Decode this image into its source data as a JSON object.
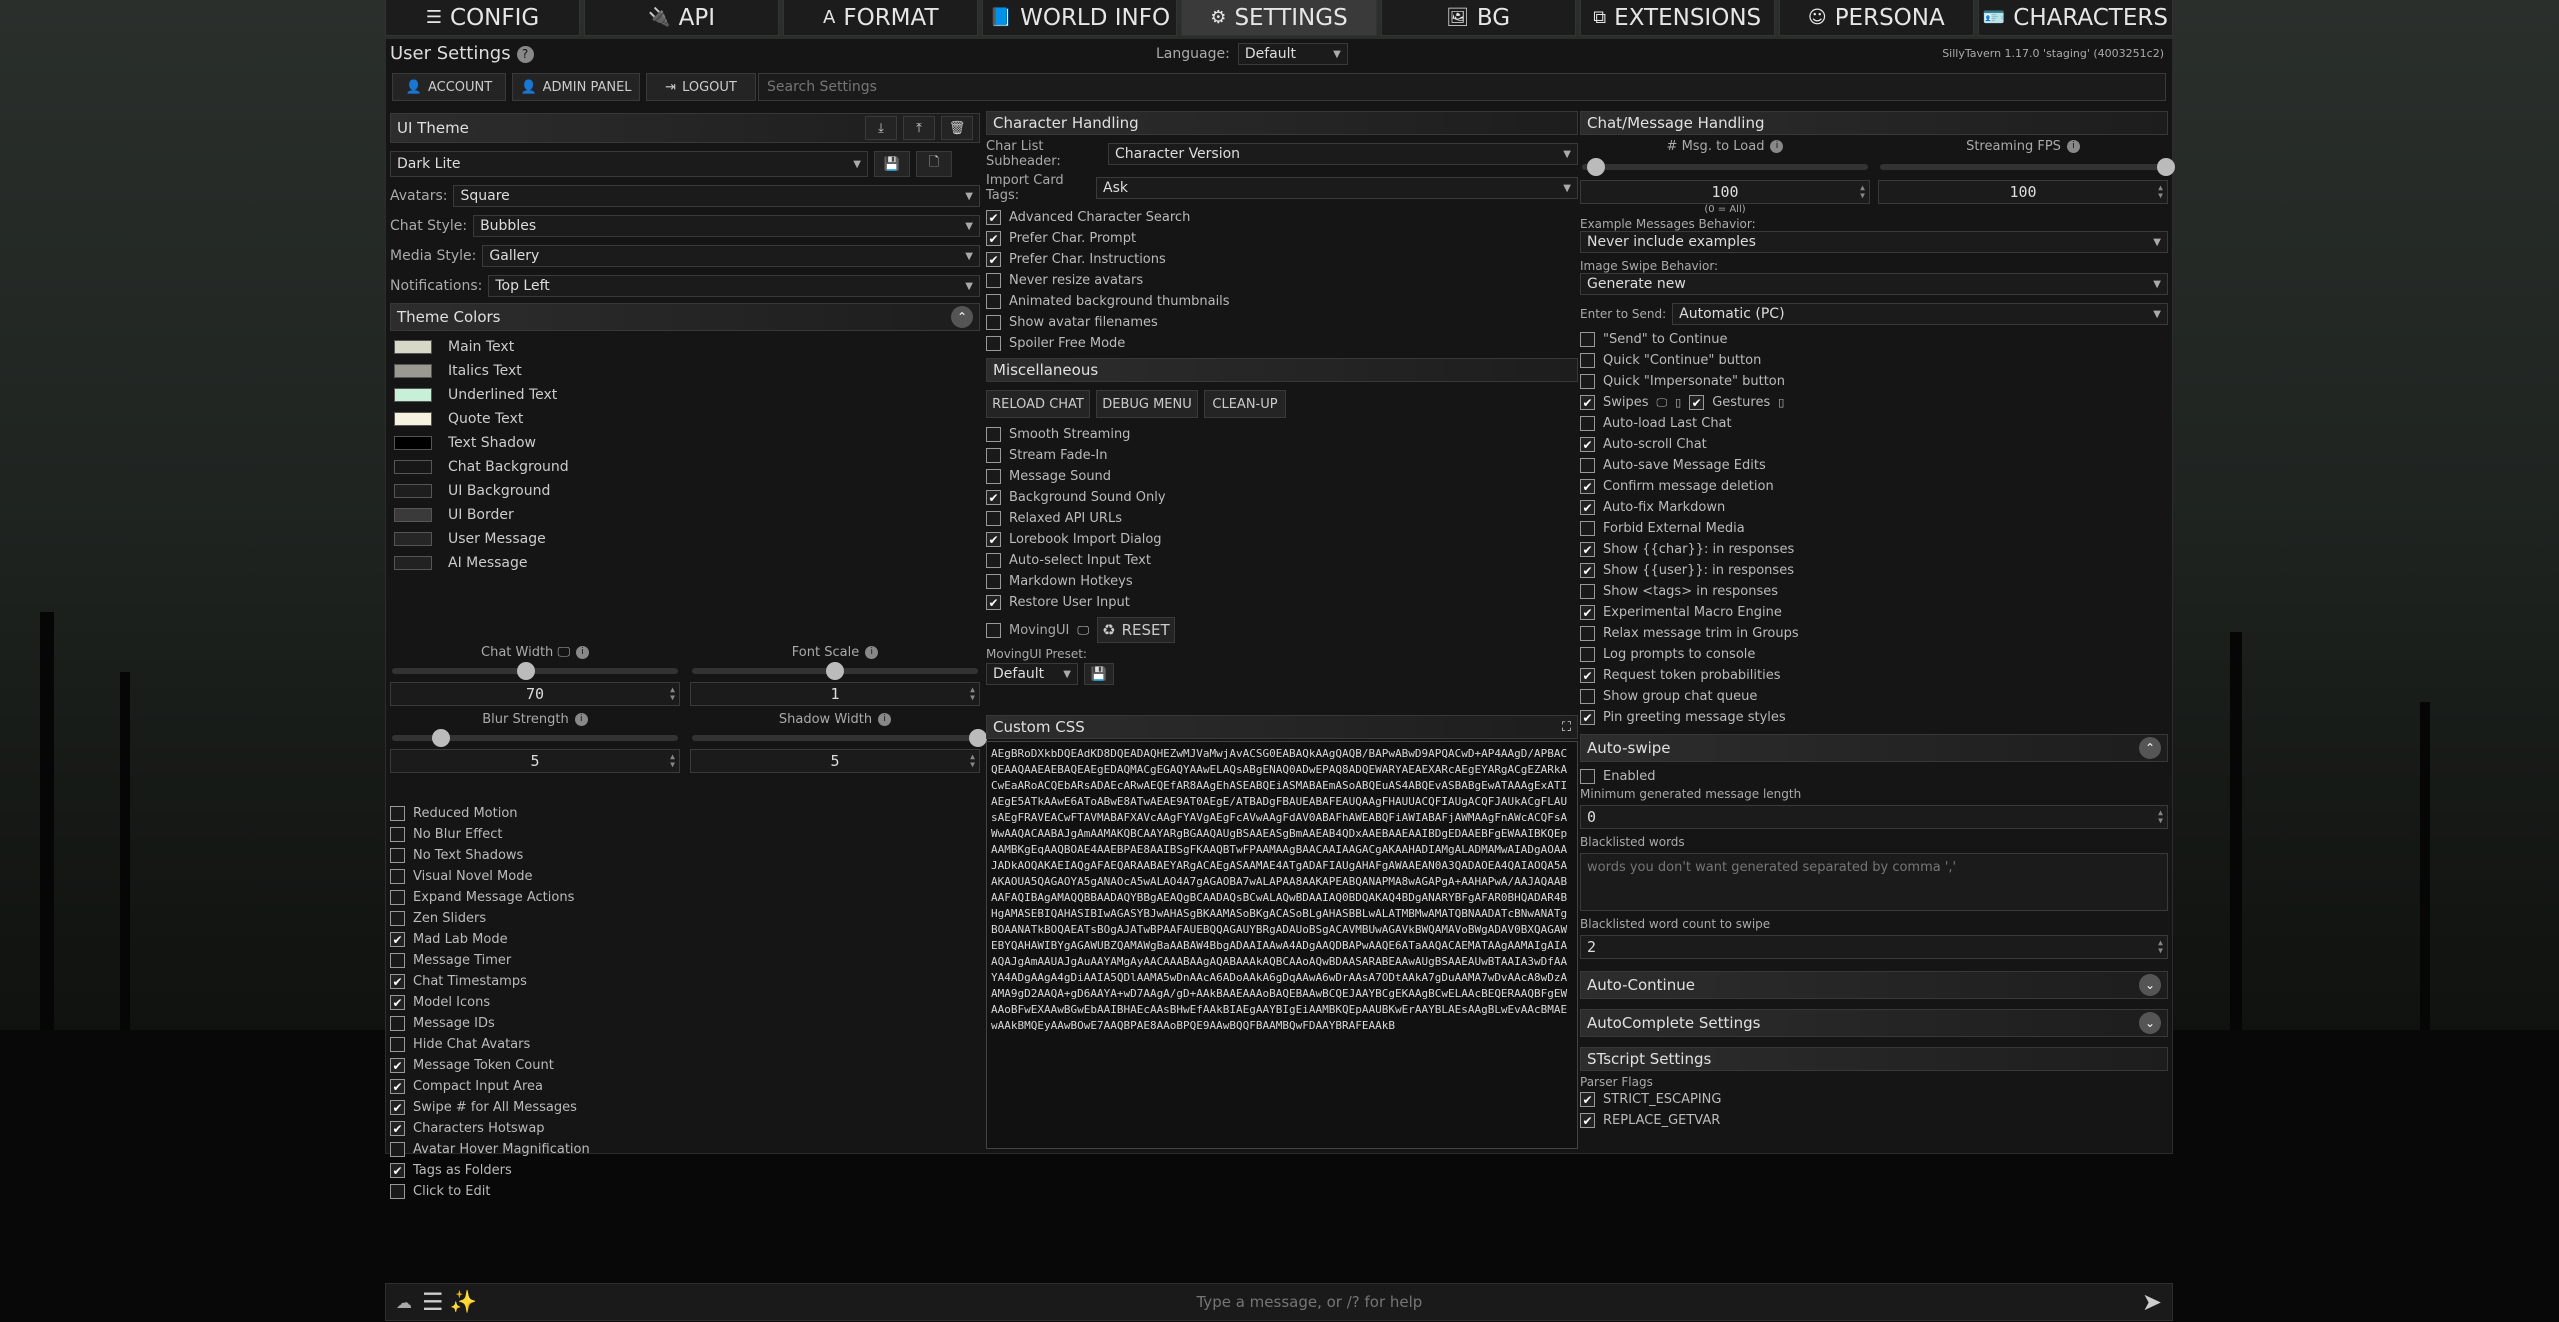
{
  "nav": {
    "tabs": [
      {
        "label": "CONFIG",
        "icon": "sliders-icon"
      },
      {
        "label": "API",
        "icon": "plug-icon"
      },
      {
        "label": "FORMAT",
        "icon": "font-icon"
      },
      {
        "label": "WORLD INFO",
        "icon": "book-icon"
      },
      {
        "label": "SETTINGS",
        "icon": "user-gear-icon"
      },
      {
        "label": "BG",
        "icon": "image-icon"
      },
      {
        "label": "EXTENSIONS",
        "icon": "cubes-icon"
      },
      {
        "label": "PERSONA",
        "icon": "face-icon"
      },
      {
        "label": "CHARACTERS",
        "icon": "id-card-icon"
      }
    ],
    "active": "SETTINGS"
  },
  "header": {
    "title": "User Settings",
    "language_label": "Language:",
    "language_value": "Default",
    "version": "SillyTavern 1.17.0 'staging' (4003251c2)",
    "buttons": {
      "account": "ACCOUNT",
      "admin": "ADMIN PANEL",
      "logout": "LOGOUT"
    },
    "search_placeholder": "Search Settings"
  },
  "ui_theme": {
    "title": "UI Theme",
    "preset": "Dark Lite",
    "avatars_label": "Avatars:",
    "avatars_value": "Square",
    "chat_style_label": "Chat Style:",
    "chat_style_value": "Bubbles",
    "media_style_label": "Media Style:",
    "media_style_value": "Gallery",
    "notifications_label": "Notifications:",
    "notifications_value": "Top Left",
    "theme_colors_title": "Theme Colors",
    "colors": [
      {
        "label": "Main Text",
        "color": "#d8d8c8"
      },
      {
        "label": "Italics Text",
        "color": "#9a9a90"
      },
      {
        "label": "Underlined Text",
        "color": "#c8f0d8"
      },
      {
        "label": "Quote Text",
        "color": "#f6f2e0"
      },
      {
        "label": "Text Shadow",
        "color": "#000000"
      },
      {
        "label": "Chat Background",
        "color": "#171717"
      },
      {
        "label": "UI Background",
        "color": "#1e1e1e"
      },
      {
        "label": "UI Border",
        "color": "#3a3a3a"
      },
      {
        "label": "User Message",
        "color": "#262626"
      },
      {
        "label": "AI Message",
        "color": "#222222"
      }
    ],
    "chat_width_label": "Chat Width",
    "chat_width_value": "70",
    "font_scale_label": "Font Scale",
    "font_scale_value": "1",
    "blur_label": "Blur Strength",
    "blur_value": "5",
    "shadow_label": "Shadow Width",
    "shadow_value": "5",
    "chat_width_level": 0.47,
    "font_scale_level": 0.5,
    "blur_level": 0.17,
    "shadow_level": 1.0,
    "toggles": [
      {
        "label": "Reduced Motion",
        "checked": false
      },
      {
        "label": "No Blur Effect",
        "checked": false
      },
      {
        "label": "No Text Shadows",
        "checked": false
      },
      {
        "label": "Visual Novel Mode",
        "checked": false
      },
      {
        "label": "Expand Message Actions",
        "checked": false
      },
      {
        "label": "Zen Sliders",
        "checked": false
      },
      {
        "label": "Mad Lab Mode",
        "checked": true
      },
      {
        "label": "Message Timer",
        "checked": false
      },
      {
        "label": "Chat Timestamps",
        "checked": true
      },
      {
        "label": "Model Icons",
        "checked": true
      },
      {
        "label": "Message IDs",
        "checked": false
      },
      {
        "label": "Hide Chat Avatars",
        "checked": false
      },
      {
        "label": "Message Token Count",
        "checked": true
      },
      {
        "label": "Compact Input Area",
        "checked": true
      },
      {
        "label": "Swipe # for All Messages",
        "checked": true
      },
      {
        "label": "Characters Hotswap",
        "checked": true
      },
      {
        "label": "Avatar Hover Magnification",
        "checked": false
      },
      {
        "label": "Tags as Folders",
        "checked": true
      },
      {
        "label": "Click to Edit",
        "checked": false
      }
    ]
  },
  "character_handling": {
    "title": "Character Handling",
    "subheader_label": "Char List Subheader:",
    "subheader_value": "Character Version",
    "import_tags_label": "Import Card Tags:",
    "import_tags_value": "Ask",
    "toggles": [
      {
        "label": "Advanced Character Search",
        "checked": true
      },
      {
        "label": "Prefer Char. Prompt",
        "checked": true
      },
      {
        "label": "Prefer Char. Instructions",
        "checked": true
      },
      {
        "label": "Never resize avatars",
        "checked": false
      },
      {
        "label": "Animated background thumbnails",
        "checked": false
      },
      {
        "label": "Show avatar filenames",
        "checked": false
      },
      {
        "label": "Spoiler Free Mode",
        "checked": false
      }
    ]
  },
  "misc": {
    "title": "Miscellaneous",
    "buttons": {
      "reload": "RELOAD CHAT",
      "debug": "DEBUG MENU",
      "cleanup": "CLEAN-UP"
    },
    "toggles": [
      {
        "label": "Smooth Streaming",
        "checked": false
      },
      {
        "label": "Stream Fade-In",
        "checked": false
      },
      {
        "label": "Message Sound",
        "checked": false
      },
      {
        "label": "Background Sound Only",
        "checked": true
      },
      {
        "label": "Relaxed API URLs",
        "checked": false
      },
      {
        "label": "Lorebook Import Dialog",
        "checked": true
      },
      {
        "label": "Auto-select Input Text",
        "checked": false
      },
      {
        "label": "Markdown Hotkeys",
        "checked": false
      },
      {
        "label": "Restore User Input",
        "checked": true
      }
    ],
    "movingui_label": "MovingUI",
    "reset_label": "RESET",
    "preset_label": "MovingUI Preset:",
    "preset_value": "Default"
  },
  "custom_css": {
    "title": "Custom CSS",
    "text": "AEgBRoDXkbDQEAdKD8DQEADAQHEZwMJVaMwjAvACSG0EABAQkAAgQAQB/BAPwABwD9APQACwD+AP4AAgD/APBACQEAAQAAEAEBAQEAEgEDAQMACgEGAQYAAwELAQsABgENAQ0ADwEPAQ8ADQEWARYAEAEXARcAEgEYARgACgEZARkACwEaARoACQEbARsADAEcARwAEQEfAR8AAgEhASEABQEiASMABAEmASoABQEuAS4ABQEvASBABgEwATAAAgExATIAEgE5ATkAAwE6AToABwE8ATwAEAE9AT0AEgE/ATBADgFBAUEABAFEAUQAAgFHAUUACQFIAUgACQFJAUkACgFLAUsAEgFRAVEACwFTAVMABAFXAVcAAgFYAVgAEgFcAVwAAgFdAV0ABAFhAWEABQFiAWIABAFjAWMAAgFnAWcACQFsAWwAAQACAABAJgAmAAMAKQBCAAYARgBGAAQAUgBSAAEASgBmAAEAB4QDxAAEBAAEAAIBDgEDAAEBFgEWAAIBKQEpAAMBKgEqAAQBOAE4AAEBPAE8AAIBSgFKAAQBTwFPAAMAAgBAACAAIAAGACgAKAAHADIAMgALADMAMwAIADgAOAAJADkAOQAKAEIAQgAFAEQARAABAEYARgACAEgASAAMAE4ATgADAFIAUgAHAFgAWAAEAN0A3QADAOEA4QAIAOQA5AAKAOUA5QAGAOYA5gANAOcA5wALAO4A7gAGAOBA7wALAPAA8AAKAPEABQANAPMA8wAGAPgA+AAHAPwA/AAJAQAABAAFAQIBAgAMAQQBBAADAQYBBgAEAQgBCAADAQsBCwALAQwBDAAIAQ0BDQAKAQ4BDgANARYBFgAFAR0BHQADAR4BHgAMASEBIQAHASIBIwAGASYBJwAHASgBKAAMASoBKgACASoBLgAHASBBLwALATMBMwAMATQBNAADATcBNwANATgBOAANATkBOQAEATsBOgAJATwBPAAFAUEBQQAGAUYBRgADAUoBSgACAVMBUwAGAVkBWQAMAVoBWgADAV0BXQAGAWEBYQAHAWIBYgAGAWUBZQAMAWgBaAABAW4BbgADAAIAAwA4ADgAAQDBAPwAAQE6ATaAAQACAEMATAAgAAMAIgAIAAQAJgAmAAUAJgAuAAYAMgAyAACAAABAAgAQABAAAkAQBCAAoAQwBDAASARABEAAwAUgBSAAEAUwBTAAIA3wDfAAYA4ADgAAgA4gDiAAIA5QDlAAMA5wDnAAcA6ADoAAkA6gDqAAwA6wDrAAsA7ODtAAkA7gDuAAMA7wDvAAcA8wDzAAMA9gD2AAQA+gD6AAYA+wD7AAgA/gD+AAkBAAEAAAoBAQEBAAwBCQEJAAYBCgEKAAgBCwELAAcBEQERAAQBFgEWAAoBFwEXAAwBGwEbAAIBHAEcAAsBHwEfAAkBIAEgAAYBIgEiAAMBKQEpAAUBKwErAAYBLAEsAAgBLwEvAAcBMAEwAAkBMQEyAAwBOwE7AAQBPAE8AAoBPQE9AAwBQQFBAAMBQwFDAAYBRAFEAAkB"
  },
  "chat_msg": {
    "title": "Chat/Message Handling",
    "msg_load_label": "# Msg. to Load",
    "msg_load_value": "100",
    "msg_load_hint": "(0 = All)",
    "fps_label": "Streaming FPS",
    "fps_value": "100",
    "msg_load_level": 0.05,
    "fps_level": 1.0,
    "example_label": "Example Messages Behavior:",
    "example_value": "Never include examples",
    "swipe_label": "Image Swipe Behavior:",
    "swipe_value": "Generate new",
    "enter_label": "Enter to Send:",
    "enter_value": "Automatic (PC)",
    "toggles": [
      {
        "label": "\"Send\" to Continue",
        "checked": false
      },
      {
        "label": "Quick \"Continue\" button",
        "checked": false
      },
      {
        "label": "Quick \"Impersonate\" button",
        "checked": false
      },
      {
        "label": "Swipes",
        "checked": true
      },
      {
        "label": "Auto-load Last Chat",
        "checked": false
      },
      {
        "label": "Auto-scroll Chat",
        "checked": true
      },
      {
        "label": "Auto-save Message Edits",
        "checked": false
      },
      {
        "label": "Confirm message deletion",
        "checked": true
      },
      {
        "label": "Auto-fix Markdown",
        "checked": true
      },
      {
        "label": "Forbid External Media",
        "checked": false
      },
      {
        "label": "Show {{char}}: in responses",
        "checked": true
      },
      {
        "label": "Show {{user}}: in responses",
        "checked": true
      },
      {
        "label": "Show <tags> in responses",
        "checked": false
      },
      {
        "label": "Experimental Macro Engine",
        "checked": true
      },
      {
        "label": "Relax message trim in Groups",
        "checked": false
      },
      {
        "label": "Log prompts to console",
        "checked": false
      },
      {
        "label": "Request token probabilities",
        "checked": true
      },
      {
        "label": "Show group chat queue",
        "checked": false
      },
      {
        "label": "Pin greeting message styles",
        "checked": true
      }
    ],
    "gestures_label": "Gestures",
    "gestures_checked": true
  },
  "auto_swipe": {
    "title": "Auto-swipe",
    "enabled_label": "Enabled",
    "min_len_label": "Minimum generated message length",
    "min_len_value": "0",
    "blacklist_label": "Blacklisted words",
    "blacklist_placeholder": "words you don't want generated separated by comma ','",
    "blacklist_count_label": "Blacklisted word count to swipe",
    "blacklist_count_value": "2"
  },
  "auto_continue": {
    "title": "Auto-Continue"
  },
  "autocomplete": {
    "title": "AutoComplete Settings"
  },
  "stscript": {
    "title": "STscript Settings",
    "parser_label": "Parser Flags",
    "flags": [
      {
        "label": "STRICT_ESCAPING",
        "checked": true
      },
      {
        "label": "REPLACE_GETVAR",
        "checked": true
      }
    ]
  },
  "chat_input": {
    "placeholder": "Type a message, or /? for help"
  }
}
